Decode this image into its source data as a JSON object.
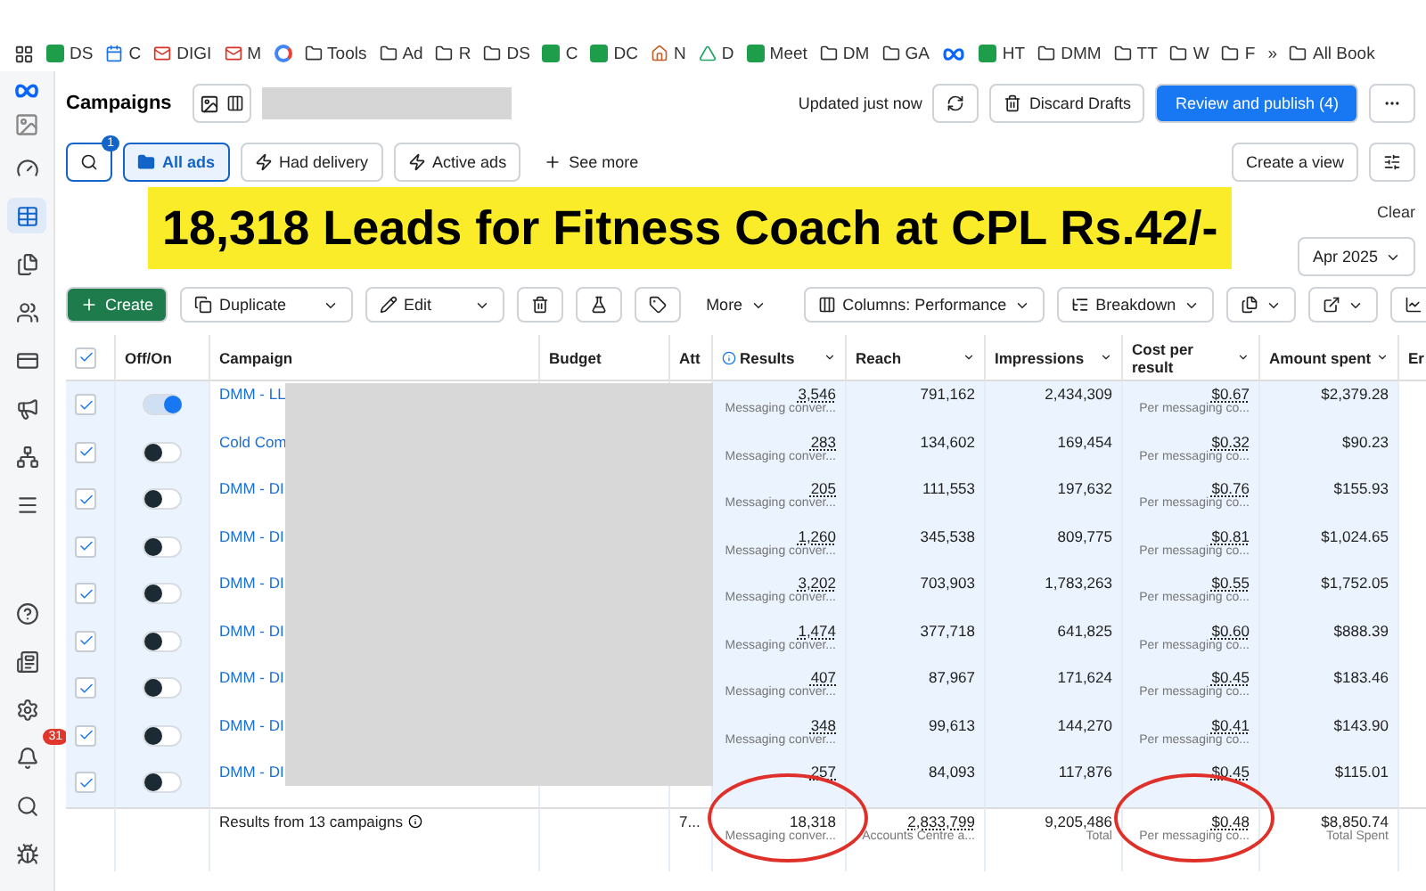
{
  "bookmarks": [
    {
      "kind": "sheet",
      "label": "DS"
    },
    {
      "kind": "calendar",
      "label": "C"
    },
    {
      "kind": "gmail",
      "label": "DIGI"
    },
    {
      "kind": "gmail",
      "label": "M"
    },
    {
      "kind": "google"
    },
    {
      "kind": "folder",
      "label": "Tools"
    },
    {
      "kind": "folder",
      "label": "Ad"
    },
    {
      "kind": "folder",
      "label": "R"
    },
    {
      "kind": "folder",
      "label": "DS"
    },
    {
      "kind": "sheet",
      "label": "C"
    },
    {
      "kind": "sheet",
      "label": "DC"
    },
    {
      "kind": "home",
      "label": "N"
    },
    {
      "kind": "drive",
      "label": "D"
    },
    {
      "kind": "sheet",
      "label": "Meet"
    },
    {
      "kind": "folder",
      "label": "DM"
    },
    {
      "kind": "folder",
      "label": "GA"
    },
    {
      "kind": "meta"
    },
    {
      "kind": "sheet",
      "label": "HT"
    },
    {
      "kind": "folder",
      "label": "DMM"
    },
    {
      "kind": "folder",
      "label": "TT"
    },
    {
      "kind": "folder",
      "label": "W"
    },
    {
      "kind": "folder",
      "label": "F"
    }
  ],
  "bookmarks_more": "»",
  "all_bookmarks": "All Book",
  "sidebar": {
    "top": [
      {
        "kind": "gauge",
        "selected": false
      },
      {
        "kind": "table",
        "selected": true
      },
      {
        "kind": "pages",
        "selected": false
      },
      {
        "kind": "people",
        "selected": false
      },
      {
        "kind": "card",
        "selected": false
      },
      {
        "kind": "megaphone",
        "selected": false
      },
      {
        "kind": "network",
        "selected": false
      },
      {
        "kind": "menu",
        "selected": false
      }
    ],
    "bottom": [
      {
        "kind": "help"
      },
      {
        "kind": "news"
      },
      {
        "kind": "settings"
      },
      {
        "kind": "bell",
        "badge": "31"
      },
      {
        "kind": "search"
      },
      {
        "kind": "bug"
      }
    ]
  },
  "header": {
    "title": "Campaigns",
    "status": "Updated just now",
    "discard": "Discard Drafts",
    "publish": "Review and publish (4)"
  },
  "filters": {
    "search_badge": "1",
    "chips": [
      {
        "label": "All ads",
        "selected": true
      },
      {
        "label": "Had delivery",
        "selected": false
      },
      {
        "label": "Active ads",
        "selected": false
      }
    ],
    "see_more": "See more",
    "create_view": "Create a view"
  },
  "filter_bar": {
    "clear": "Clear"
  },
  "banner": "18,318 Leads for Fitness Coach at CPL Rs.42/-",
  "date_range": "Apr 2025",
  "toolbar": {
    "create": "Create",
    "duplicate": "Duplicate",
    "edit": "Edit",
    "more": "More",
    "columns": "Columns: Performance",
    "breakdown": "Breakdown"
  },
  "table": {
    "all_checked": true,
    "columns": [
      "Off/On",
      "Campaign",
      "Budget",
      "Att",
      "Results",
      "Reach",
      "Impressions",
      "Cost per result",
      "Amount spent",
      "Er"
    ],
    "rows": [
      {
        "checked": true,
        "on": true,
        "name": "DMM - LL",
        "results": "3,546",
        "results_sub": "Messaging conver...",
        "reach": "791,162",
        "impressions": "2,434,309",
        "cpr": "$0.67",
        "cpr_sub": "Per messaging co...",
        "amount": "$2,379.28"
      },
      {
        "checked": true,
        "on": false,
        "name": "Cold Com",
        "results": "283",
        "results_sub": "Messaging conver...",
        "reach": "134,602",
        "impressions": "169,454",
        "cpr": "$0.32",
        "cpr_sub": "Per messaging co...",
        "amount": "$90.23"
      },
      {
        "checked": true,
        "on": false,
        "name": "DMM - DI",
        "results": "205",
        "results_sub": "Messaging conver...",
        "reach": "111,553",
        "impressions": "197,632",
        "cpr": "$0.76",
        "cpr_sub": "Per messaging co...",
        "amount": "$155.93"
      },
      {
        "checked": true,
        "on": false,
        "name": "DMM - DI",
        "results": "1,260",
        "results_sub": "Messaging conver...",
        "reach": "345,538",
        "impressions": "809,775",
        "cpr": "$0.81",
        "cpr_sub": "Per messaging co...",
        "amount": "$1,024.65"
      },
      {
        "checked": true,
        "on": false,
        "name": "DMM - DI",
        "results": "3,202",
        "results_sub": "Messaging conver...",
        "reach": "703,903",
        "impressions": "1,783,263",
        "cpr": "$0.55",
        "cpr_sub": "Per messaging co...",
        "amount": "$1,752.05"
      },
      {
        "checked": true,
        "on": false,
        "name": "DMM - DI",
        "results": "1,474",
        "results_sub": "Messaging conver...",
        "reach": "377,718",
        "impressions": "641,825",
        "cpr": "$0.60",
        "cpr_sub": "Per messaging co...",
        "amount": "$888.39"
      },
      {
        "checked": true,
        "on": false,
        "name": "DMM - DI",
        "results": "407",
        "results_sub": "Messaging conver...",
        "reach": "87,967",
        "impressions": "171,624",
        "cpr": "$0.45",
        "cpr_sub": "Per messaging co...",
        "amount": "$183.46"
      },
      {
        "checked": true,
        "on": false,
        "name": "DMM - DI",
        "results": "348",
        "results_sub": "Messaging conver...",
        "reach": "99,613",
        "impressions": "144,270",
        "cpr": "$0.41",
        "cpr_sub": "Per messaging co...",
        "amount": "$143.90"
      },
      {
        "checked": true,
        "on": false,
        "name": "DMM - DI",
        "results": "257",
        "reach": "84,093",
        "impressions": "117,876",
        "cpr": "$0.45",
        "amount": "$115.01"
      }
    ],
    "footer": {
      "label": "Results from 13 campaigns",
      "att": "7...",
      "results": "18,318",
      "results_sub": "Messaging conver...",
      "reach": "2,833,799",
      "reach_sub": "Accounts Centre a...",
      "impressions": "9,205,486",
      "impressions_sub": "Total",
      "cpr": "$0.48",
      "cpr_sub": "Per messaging co...",
      "amount": "$8,850.74",
      "amount_sub": "Total Spent"
    }
  }
}
